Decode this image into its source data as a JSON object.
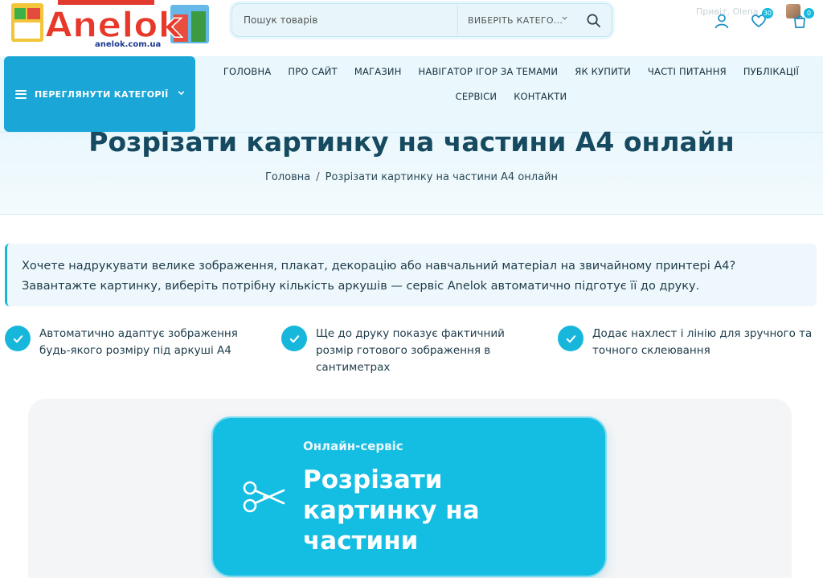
{
  "header": {
    "logo_text": "Anelok",
    "logo_domain": "anelok.com.ua",
    "search_placeholder": "Пошук товарів",
    "category_select": "ВИБЕРІТЬ КАТЕГО...",
    "greeting": "Привіт, Olena",
    "wishlist_count": "30",
    "cart_count": "0"
  },
  "nav": {
    "categories_button": "ПЕРЕГЛЯНУТИ КАТЕГОРІЇ",
    "row1": [
      "ГОЛОВНА",
      "ПРО САЙТ",
      "МАГАЗИН",
      "НАВІГАТОР ІГОР ЗА ТЕМАМИ",
      "ЯК КУПИТИ",
      "ЧАСТІ ПИТАННЯ",
      "ПУБЛІКАЦІЇ"
    ],
    "row2": [
      "СЕРВІСИ",
      "КОНТАКТИ"
    ]
  },
  "hero": {
    "title": "Розрізати картинку на частини А4 онлайн",
    "breadcrumb_home": "Головна",
    "breadcrumb_separator": "/",
    "breadcrumb_current": "Розрізати картинку на частини А4 онлайн"
  },
  "intro": {
    "text": "Хочете надрукувати велике зображення, плакат, декорацію або навчальний матеріал на звичайному принтері А4? Завантажте картинку, виберіть потрібну кількість аркушів — сервіс Anelok автоматично підготує її до друку."
  },
  "features": [
    "Автоматично адаптує зображення будь-якого розміру під аркуші А4",
    "Ще до друку показує фактичний розмір готового зображення в сантиметрах",
    "Додає нахлест і лінію для зручного та точного склеювання"
  ],
  "service_card": {
    "subtitle": "Онлайн-сервіс",
    "title": "Розрізати картинку на частини"
  },
  "colors": {
    "accent": "#17b7db",
    "category_button": "#1aa6d6",
    "title": "#164a60"
  }
}
